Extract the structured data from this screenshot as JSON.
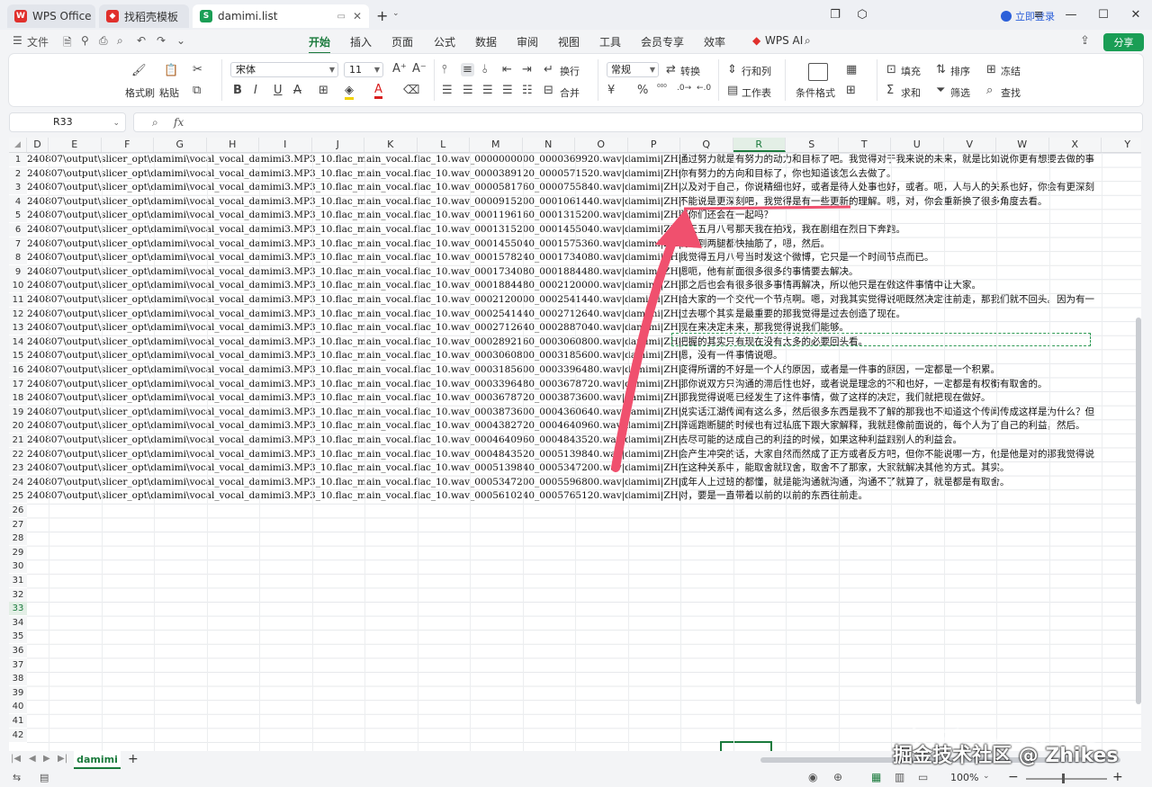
{
  "tabs": [
    {
      "label": "WPS Office"
    },
    {
      "label": "找稻壳模板"
    },
    {
      "label": "damimi.list"
    }
  ],
  "titlebar": {
    "login": "立即登录"
  },
  "quick_access": {
    "file": "文件"
  },
  "menu": [
    "开始",
    "插入",
    "页面",
    "公式",
    "数据",
    "审阅",
    "视图",
    "工具",
    "会员专享",
    "效率",
    "WPS AI"
  ],
  "active_menu": "开始",
  "share": "分享",
  "ribbon": {
    "format_painter": "格式刷",
    "paste": "粘贴",
    "font_name": "宋体",
    "font_size": "11",
    "wrap": "换行",
    "merge": "合并",
    "number_format": "常规",
    "convert": "转换",
    "row_col": "行和列",
    "worksheet": "工作表",
    "cond_format": "条件格式",
    "fill": "填充",
    "sort": "排序",
    "freeze": "冻结",
    "sum": "求和",
    "filter": "筛选",
    "find": "查找"
  },
  "formula_bar": {
    "name_box": "R33",
    "fx": "fx",
    "formula": ""
  },
  "columns": [
    "D",
    "E",
    "F",
    "G",
    "H",
    "I",
    "J",
    "K",
    "L",
    "M",
    "N",
    "O",
    "P",
    "Q",
    "R",
    "S",
    "T",
    "U",
    "V",
    "W",
    "X",
    "Y"
  ],
  "selected_column": "R",
  "selected_row": 33,
  "row_numbers": [
    1,
    2,
    3,
    4,
    5,
    6,
    7,
    8,
    9,
    10,
    11,
    12,
    13,
    14,
    15,
    16,
    17,
    18,
    19,
    20,
    21,
    22,
    23,
    24,
    25,
    26,
    27,
    28,
    29,
    30,
    31,
    32,
    33,
    34,
    35,
    36,
    37,
    38,
    39,
    40,
    41,
    42
  ],
  "path_prefix": "240807\\output\\slicer_opt\\damimi\\vocal_vocal_damimi3.MP3_10.flac_main_vocal.flac_10.wav_",
  "rows": [
    {
      "n": 1,
      "path": "240807\\output\\slicer_opt\\damimi\\vocal_vocal_damimi3.MP3_10.flac_main_vocal.flac_10.wav_0000000000_0000369920.wav|damimi|ZH|",
      "text": "通过努力就是有努力的动力和目标了吧。我觉得对于我来说的未来，就是比如说你更有想要去做的事"
    },
    {
      "n": 2,
      "path": "240807\\output\\slicer_opt\\damimi\\vocal_vocal_damimi3.MP3_10.flac_main_vocal.flac_10.wav_0000389120_0000571520.wav|damimi|ZH|",
      "text": "你有努力的方向和目标了，你也知道该怎么去做了。"
    },
    {
      "n": 3,
      "path": "240807\\output\\slicer_opt\\damimi\\vocal_vocal_damimi3.MP3_10.flac_main_vocal.flac_10.wav_0000581760_0000755840.wav|damimi|ZH|",
      "text": "以及对于自己，你说精细也好，或者是待人处事也好，或者。呃，人与人的关系也好，你会有更深刻"
    },
    {
      "n": 4,
      "path": "240807\\output\\slicer_opt\\damimi\\vocal_vocal_damimi3.MP3_10.flac_main_vocal.flac_10.wav_0000915200_0001061440.wav|damimi|ZH|",
      "text": "不能说是更深刻吧，我觉得是有一些更新的理解。嗯，对，你会重新换了很多角度去看。"
    },
    {
      "n": 5,
      "path": "240807\\output\\slicer_opt\\damimi\\vocal_vocal_damimi3.MP3_10.flac_main_vocal.flac_10.wav_0001196160_0001315200.wav|damimi|ZH|",
      "text": "那你们还会在一起吗？"
    },
    {
      "n": 6,
      "path": "240807\\output\\slicer_opt\\damimi\\vocal_vocal_damimi3.MP3_10.flac_main_vocal.flac_10.wav_0001315200_0001455040.wav|damimi|ZH|",
      "text": "今天五月八号那天我在拍戏，我在剧组在烈日下奔跑。"
    },
    {
      "n": 7,
      "path": "240807\\output\\slicer_opt\\damimi\\vocal_vocal_damimi3.MP3_10.flac_main_vocal.flac_10.wav_0001455040_0001575360.wav|damimi|ZH|",
      "text": "我跑到两腿都快抽筋了，嗯，然后。"
    },
    {
      "n": 8,
      "path": "240807\\output\\slicer_opt\\damimi\\vocal_vocal_damimi3.MP3_10.flac_main_vocal.flac_10.wav_0001578240_0001734080.wav|damimi|ZH|",
      "text": "我觉得五月八号当时发这个微博，它只是一个时间节点而已。"
    },
    {
      "n": 9,
      "path": "240807\\output\\slicer_opt\\damimi\\vocal_vocal_damimi3.MP3_10.flac_main_vocal.flac_10.wav_0001734080_0001884480.wav|damimi|ZH|",
      "text": "嗯呃，他有前面很多很多的事情要去解决。"
    },
    {
      "n": 10,
      "path": "240807\\output\\slicer_opt\\damimi\\vocal_vocal_damimi3.MP3_10.flac_main_vocal.flac_10.wav_0001884480_0002120000.wav|damimi|ZH|",
      "text": "那之后也会有很多很多事情再解决，所以他只是在做这件事情中让大家。"
    },
    {
      "n": 11,
      "path": "240807\\output\\slicer_opt\\damimi\\vocal_vocal_damimi3.MP3_10.flac_main_vocal.flac_10.wav_0002120000_0002541440.wav|damimi|ZH|",
      "text": "给大家的一个交代一个节点啊。嗯，对我其实觉得说呃既然决定往前走，那我们就不回头。因为有一"
    },
    {
      "n": 12,
      "path": "240807\\output\\slicer_opt\\damimi\\vocal_vocal_damimi3.MP3_10.flac_main_vocal.flac_10.wav_0002541440_0002712640.wav|damimi|ZH|",
      "text": "过去哪个其实是最重要的那我觉得是过去创造了现在。"
    },
    {
      "n": 13,
      "path": "240807\\output\\slicer_opt\\damimi\\vocal_vocal_damimi3.MP3_10.flac_main_vocal.flac_10.wav_0002712640_0002887040.wav|damimi|ZH|",
      "text": "现在来决定未来，那我觉得说我们能够。"
    },
    {
      "n": 14,
      "path": "240807\\output\\slicer_opt\\damimi\\vocal_vocal_damimi3.MP3_10.flac_main_vocal.flac_10.wav_0002892160_0003060800.wav|damimi|ZH|",
      "text": "把握的其实只有现在没有太多的必要回头看。"
    },
    {
      "n": 15,
      "path": "240807\\output\\slicer_opt\\damimi\\vocal_vocal_damimi3.MP3_10.flac_main_vocal.flac_10.wav_0003060800_0003185600.wav|damimi|ZH|",
      "text": "嗯，没有一件事情说嗯。"
    },
    {
      "n": 16,
      "path": "240807\\output\\slicer_opt\\damimi\\vocal_vocal_damimi3.MP3_10.flac_main_vocal.flac_10.wav_0003185600_0003396480.wav|damimi|ZH|",
      "text": "变得所谓的不好是一个人的原因，或者是一件事的原因，一定都是一个积累。"
    },
    {
      "n": 17,
      "path": "240807\\output\\slicer_opt\\damimi\\vocal_vocal_damimi3.MP3_10.flac_main_vocal.flac_10.wav_0003396480_0003678720.wav|damimi|ZH|",
      "text": "那你说双方只沟通的滞后性也好，或者说是理念的不和也好，一定都是有权衡有取舍的。"
    },
    {
      "n": 18,
      "path": "240807\\output\\slicer_opt\\damimi\\vocal_vocal_damimi3.MP3_10.flac_main_vocal.flac_10.wav_0003678720_0003873600.wav|damimi|ZH|",
      "text": "那我觉得说嗯已经发生了这件事情，做了这样的决定，我们就把现在做好。"
    },
    {
      "n": 19,
      "path": "240807\\output\\slicer_opt\\damimi\\vocal_vocal_damimi3.MP3_10.flac_main_vocal.flac_10.wav_0003873600_0004360640.wav|damimi|ZH|",
      "text": "说实话江湖传闻有这么多，然后很多东西是我不了解的那我也不知道这个传闻传成这样是为什么？但"
    },
    {
      "n": 20,
      "path": "240807\\output\\slicer_opt\\damimi\\vocal_vocal_damimi3.MP3_10.flac_main_vocal.flac_10.wav_0004382720_0004640960.wav|damimi|ZH|",
      "text": "辟谣跑断腿的时候也有过私底下跟大家解释，我就是像前面说的，每个人为了自己的利益，然后。"
    },
    {
      "n": 21,
      "path": "240807\\output\\slicer_opt\\damimi\\vocal_vocal_damimi3.MP3_10.flac_main_vocal.flac_10.wav_0004640960_0004843520.wav|damimi|ZH|",
      "text": "去尽可能的达成自己的利益的时候，如果这种利益跟别人的利益会。"
    },
    {
      "n": 22,
      "path": "240807\\output\\slicer_opt\\damimi\\vocal_vocal_damimi3.MP3_10.flac_main_vocal.flac_10.wav_0004843520_0005139840.wav|damimi|ZH|",
      "text": "会产生冲突的话，大家自然而然成了正方或者反方吧，但你不能说哪一方，他是他是对的那我觉得说"
    },
    {
      "n": 23,
      "path": "240807\\output\\slicer_opt\\damimi\\vocal_vocal_damimi3.MP3_10.flac_main_vocal.flac_10.wav_0005139840_0005347200.wav|damimi|ZH|",
      "text": "在这种关系中，能取舍就取舍，取舍不了那家，大家就解决其他的方式。其实。"
    },
    {
      "n": 24,
      "path": "240807\\output\\slicer_opt\\damimi\\vocal_vocal_damimi3.MP3_10.flac_main_vocal.flac_10.wav_0005347200_0005596800.wav|damimi|ZH|",
      "text": "成年人上过班的都懂，就是能沟通就沟通，沟通不了就算了，就是都是有取舍。"
    },
    {
      "n": 25,
      "path": "240807\\output\\slicer_opt\\damimi\\vocal_vocal_damimi3.MP3_10.flac_main_vocal.flac_10.wav_0005610240_0005765120.wav|damimi|ZH|",
      "text": "对，要是一直带着以前的以前的东西往前走。"
    }
  ],
  "sheet_tab": "damimi",
  "status": {
    "zoom": "100%"
  },
  "watermark": {
    "line1": "知乎 @Zhikes",
    "line2": "掘金技术社区 @ Zhikes"
  },
  "colors": {
    "accent": "#1a7a3c",
    "share": "#1a9e55",
    "arrow": "#f0506e",
    "link": "#2b5fd9"
  }
}
